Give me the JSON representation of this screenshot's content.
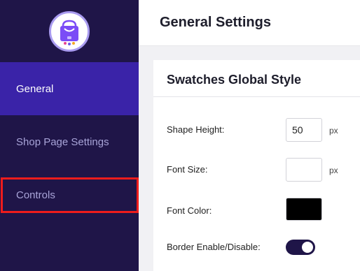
{
  "sidebar": {
    "logo": {
      "icon": "shopping-bag-icon",
      "colors": {
        "bag": "#7b4cf6",
        "dot1": "#e84393",
        "dot2": "#6c5ce7",
        "dot3": "#f5a623"
      }
    },
    "items": [
      {
        "label": "General",
        "active": true
      },
      {
        "label": "Shop Page Settings",
        "active": false
      },
      {
        "label": "Controls",
        "active": false
      }
    ]
  },
  "header": {
    "title": "General Settings"
  },
  "panel": {
    "title": "Swatches Global Style",
    "shape_height": {
      "label": "Shape Height:",
      "value": "50",
      "unit": "px"
    },
    "font_size": {
      "label": "Font Size:",
      "value": "",
      "unit": "px"
    },
    "font_color": {
      "label": "Font Color:",
      "value": "#000000"
    },
    "border": {
      "label": "Border Enable/Disable:",
      "enabled": true
    }
  },
  "colors": {
    "sidebar_bg": "#1f1548",
    "active_item_bg": "#3a23a8",
    "highlight": "#ee1c1c"
  }
}
